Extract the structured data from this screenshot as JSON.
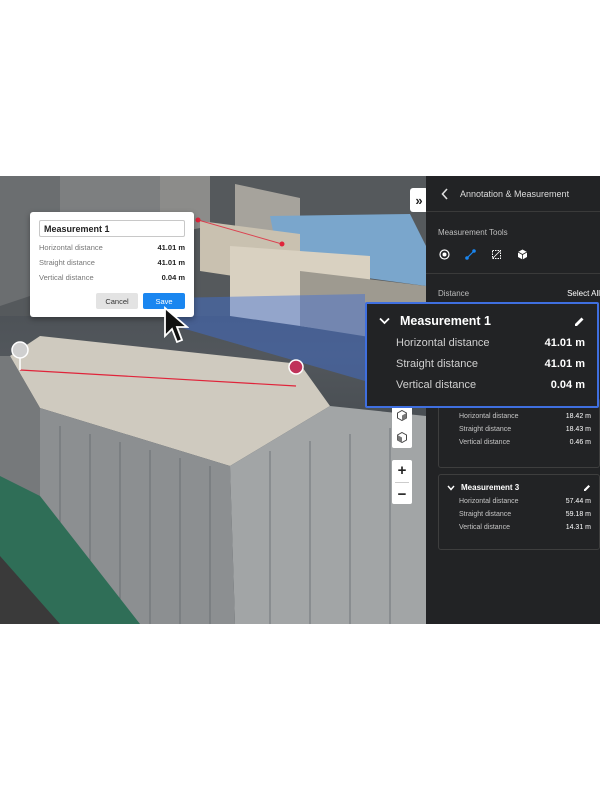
{
  "dialog": {
    "name_value": "Measurement 1",
    "rows": [
      {
        "label": "Horizontal distance",
        "value": "41.01 m"
      },
      {
        "label": "Straight distance",
        "value": "41.01 m"
      },
      {
        "label": "Vertical distance",
        "value": "0.04 m"
      }
    ],
    "cancel_label": "Cancel",
    "save_label": "Save"
  },
  "panel_toggle_label": "»",
  "zoom_controls": {
    "plus": "+",
    "minus": "−"
  },
  "sidebar": {
    "title": "Annotation & Measurement",
    "tools_label": "Measurement Tools",
    "tools": [
      "point-measure-icon",
      "distance-measure-icon",
      "area-measure-icon",
      "volume-measure-icon"
    ],
    "distance_label": "Distance",
    "select_all_label": "Select All",
    "measurement2": {
      "rows": [
        {
          "label": "Horizontal distance",
          "value": "18.42 m"
        },
        {
          "label": "Straight distance",
          "value": "18.43 m"
        },
        {
          "label": "Vertical distance",
          "value": "0.46 m"
        }
      ]
    },
    "measurement3": {
      "title": "Measurement 3",
      "rows": [
        {
          "label": "Horizontal distance",
          "value": "57.44 m"
        },
        {
          "label": "Straight distance",
          "value": "59.18 m"
        },
        {
          "label": "Vertical distance",
          "value": "14.31 m"
        }
      ]
    }
  },
  "zoom_card": {
    "title": "Measurement 1",
    "rows": [
      {
        "label": "Horizontal distance",
        "value": "41.01 m"
      },
      {
        "label": "Straight distance",
        "value": "41.01 m"
      },
      {
        "label": "Vertical distance",
        "value": "0.04 m"
      }
    ]
  },
  "colors": {
    "accent": "#1a86f0",
    "highlight_border": "#3f6fe0",
    "measure_line": "#e0243a",
    "panel_bg": "#222325"
  }
}
